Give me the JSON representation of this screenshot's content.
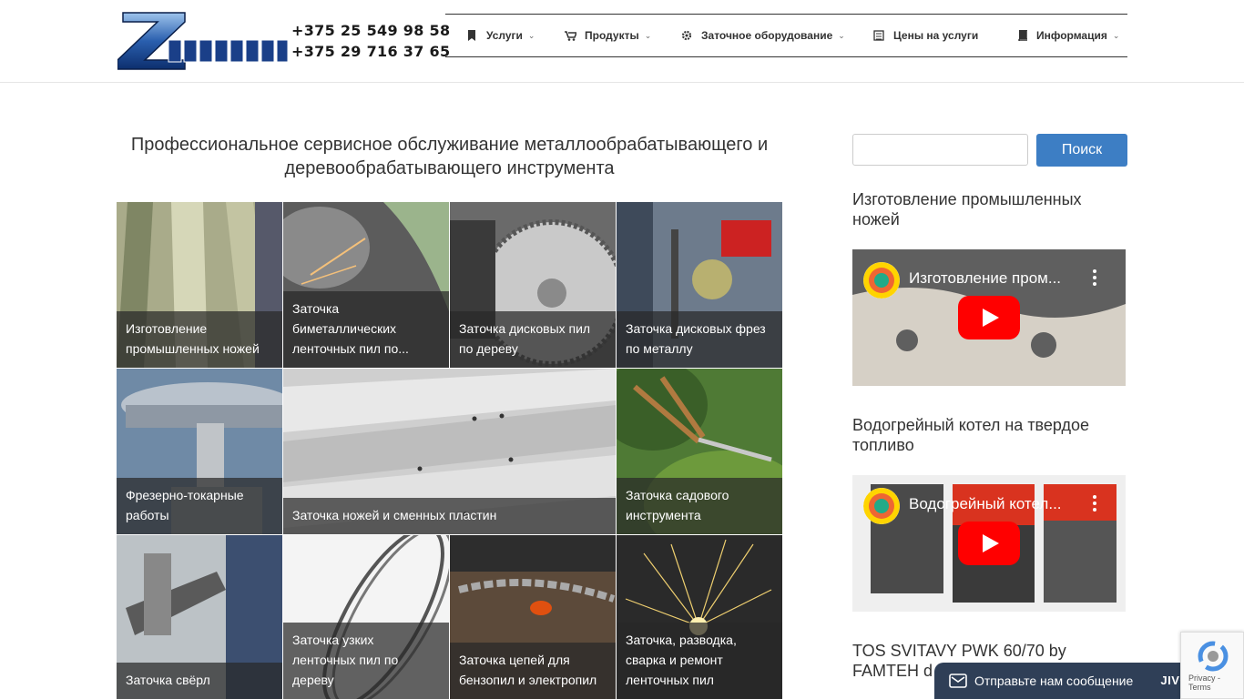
{
  "header": {
    "phones": [
      "+375 25 549 98 58",
      "+375 29 716 37 65"
    ],
    "logo_text": "ZATOCHNIK"
  },
  "nav": [
    {
      "label": "Услуги",
      "icon": "bookmark-icon",
      "dropdown": true
    },
    {
      "label": "Продукты",
      "icon": "cart-icon",
      "dropdown": true
    },
    {
      "label": "Заточное оборудование",
      "icon": "gear-icon",
      "dropdown": true
    },
    {
      "label": "Цены на услуги",
      "icon": "money-icon",
      "dropdown": false
    },
    {
      "label": "Информация",
      "icon": "book-icon",
      "dropdown": true
    }
  ],
  "main": {
    "title": "Профессиональное сервисное обслуживание металлообрабатывающего и деревообрабатывающего инструмента",
    "tiles": [
      {
        "label": "Изготовление промышленных ножей"
      },
      {
        "label": "Заточка биметаллических ленточных пил по..."
      },
      {
        "label": "Заточка дисковых пил по дереву"
      },
      {
        "label": "Заточка дисковых фрез по металлу"
      },
      {
        "label": "Фрезерно-токарные работы"
      },
      {
        "label": "Заточка ножей и сменных пластин"
      },
      {
        "label": "Заточка садового инструмента"
      },
      {
        "label": "Заточка свёрл"
      },
      {
        "label": "Заточка узких ленточных пил по дереву"
      },
      {
        "label": "Заточка цепей для бензопил и электропил"
      },
      {
        "label": "Заточка, разводка, сварка и ремонт ленточных пил"
      }
    ]
  },
  "sidebar": {
    "search_value": "",
    "search_button": "Поиск",
    "widgets": [
      {
        "title": "Изготовление промышленных ножей",
        "video_title": "Изготовление пром..."
      },
      {
        "title": "Водогрейный котел на твердое топливо",
        "video_title": "Водогрейный котел..."
      },
      {
        "title": "TOS SVITAVY PWK 60/70 by FAMTEH d"
      }
    ]
  },
  "chat": {
    "label": "Отправьте нам сообщение",
    "brand": "JIVO"
  },
  "recaptcha": {
    "terms": "Privacy - Terms"
  },
  "colors": {
    "accent": "#3d7ec4",
    "chat_bg": "#2f3f57",
    "caption_bg": "#282828"
  }
}
